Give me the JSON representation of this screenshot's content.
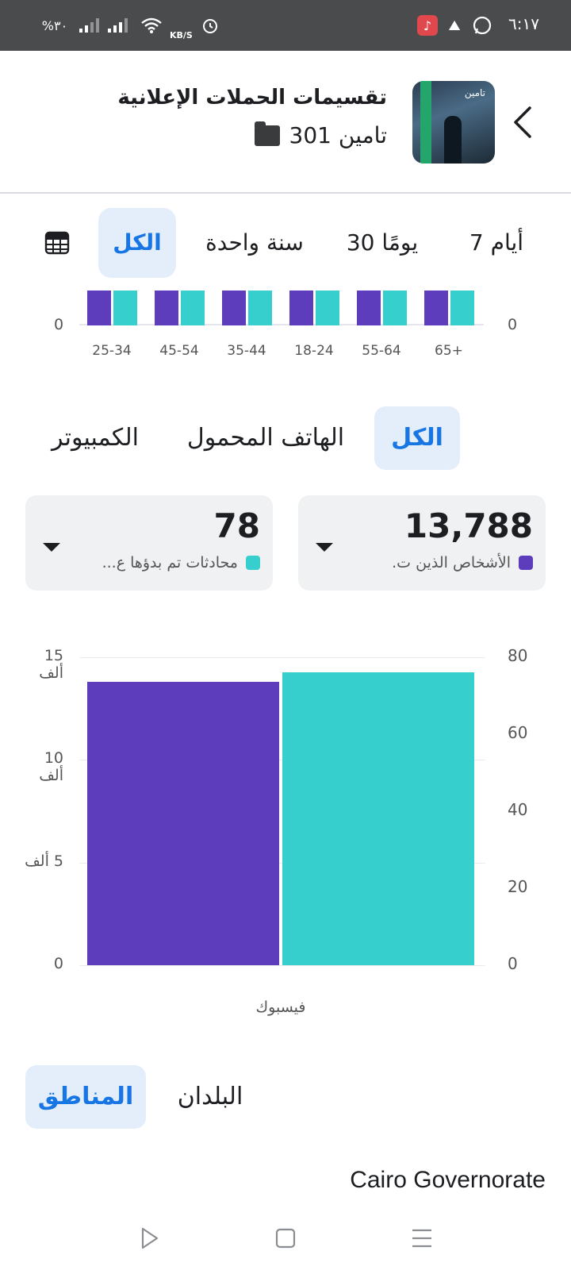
{
  "status_bar": {
    "time": "٦:١٧",
    "battery": "%٣٠",
    "net_unit": "KB/S"
  },
  "header": {
    "title": "تقسيمات الحملات الإعلانية",
    "subtitle": "تامين 301",
    "thumbnail_text": "تامين"
  },
  "range_tabs": {
    "days7": "7 أيام",
    "days30": "30 يومًا",
    "year": "سنة واحدة",
    "all": "الكل",
    "active": "all"
  },
  "age_chart": {
    "left_zero": "0",
    "right_zero": "0",
    "groups": [
      "25-34",
      "45-54",
      "35-44",
      "18-24",
      "55-64",
      "65+"
    ]
  },
  "device_tabs": {
    "all": "الكل",
    "mobile": "الهاتف المحمول",
    "desktop": "الكمبيوتر",
    "active": "all"
  },
  "metrics": {
    "reach": {
      "value": "13,788",
      "label": "الأشخاص الذين ت.",
      "color": "#5e3dbd"
    },
    "conversations": {
      "value": "78",
      "label": "محادثات تم بدؤها ع...",
      "color": "#36cfcd"
    }
  },
  "chart_data": {
    "type": "bar",
    "categories": [
      "فيسبوك"
    ],
    "series": [
      {
        "name": "الأشخاص الذين ت.",
        "values": [
          13788
        ],
        "color": "#5e3dbd",
        "axis": "left"
      },
      {
        "name": "محادثات تم بدؤها ع...",
        "values": [
          76
        ],
        "color": "#36cfcd",
        "axis": "right"
      }
    ],
    "left_axis": {
      "ylim": [
        0,
        15000
      ],
      "ticks": [
        "0",
        "5 ألف",
        "10 ألف",
        "15 ألف"
      ]
    },
    "right_axis": {
      "ylim": [
        0,
        80
      ],
      "ticks": [
        "0",
        "20",
        "40",
        "60",
        "80"
      ]
    },
    "grid": true
  },
  "geo_tabs": {
    "regions": "المناطق",
    "countries": "البلدان",
    "active": "regions"
  },
  "region_list": {
    "first": "Cairo Governorate"
  },
  "colors": {
    "accent": "#1876e4",
    "purple": "#5e3dbd",
    "teal": "#36cfcd"
  }
}
